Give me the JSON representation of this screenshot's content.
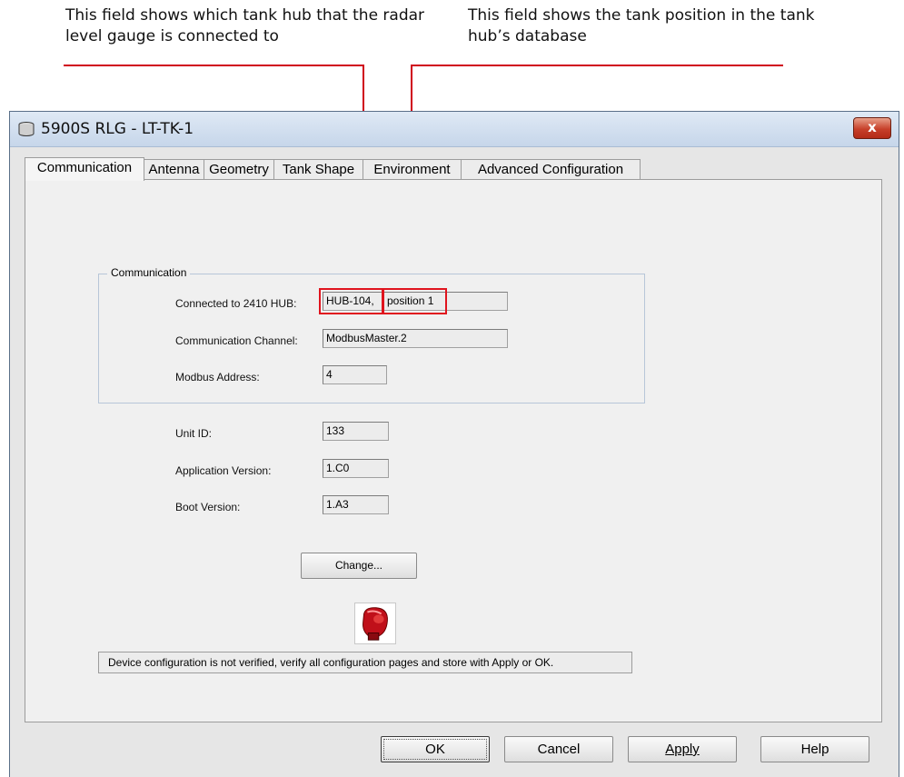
{
  "annotations": {
    "left": "This field shows which tank hub that the radar level gauge is connected to",
    "right": "This field shows the tank position in the tank hub’s database",
    "accent_color": "#e0141e"
  },
  "window": {
    "title": "5900S RLG  - LT-TK-1",
    "close_label": "x",
    "title_icon": "tank-icon"
  },
  "tabs": [
    {
      "label": "Communication",
      "active": true
    },
    {
      "label": "Antenna"
    },
    {
      "label": "Geometry"
    },
    {
      "label": "Tank Shape"
    },
    {
      "label": "Environment"
    },
    {
      "label": "Advanced Configuration"
    }
  ],
  "communication": {
    "group_label": "Communication",
    "hub_label": "Connected to 2410 HUB:",
    "hub_value": "HUB-104,",
    "position_value": "position 1",
    "channel_label": "Communication Channel:",
    "channel_value": "ModbusMaster.2",
    "modbus_label": "Modbus Address:",
    "modbus_value": "4"
  },
  "info": {
    "unit_id_label": "Unit ID:",
    "unit_id_value": "133",
    "app_version_label": "Application Version:",
    "app_version_value": "1.C0",
    "boot_version_label": "Boot Version:",
    "boot_version_value": "1.A3"
  },
  "change_button": "Change...",
  "status_icon": "boxing-glove-icon",
  "status_message": "Device configuration is not verified, verify all configuration pages and store with Apply or OK.",
  "buttons": {
    "ok": "OK",
    "cancel": "Cancel",
    "apply": "Apply",
    "help": "Help"
  }
}
